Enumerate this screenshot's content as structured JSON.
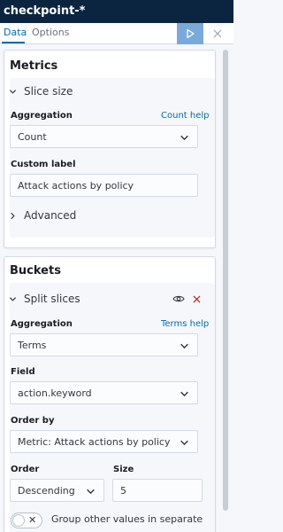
{
  "header": {
    "title": "checkpoint-*"
  },
  "tabs": [
    {
      "label": "Data",
      "active": true
    },
    {
      "label": "Options",
      "active": false
    }
  ],
  "toolbar": {
    "run_icon": "play-icon",
    "close_icon": "close-icon"
  },
  "metrics": {
    "title": "Metrics",
    "agg_title": "Slice size",
    "aggregation_label": "Aggregation",
    "aggregation_help": "Count help",
    "aggregation_value": "Count",
    "custom_label_label": "Custom label",
    "custom_label_value": "Attack actions by policy",
    "advanced_label": "Advanced"
  },
  "buckets": {
    "title": "Buckets",
    "agg_title": "Split slices",
    "aggregation_label": "Aggregation",
    "aggregation_help": "Terms help",
    "aggregation_value": "Terms",
    "field_label": "Field",
    "field_value": "action.keyword",
    "order_by_label": "Order by",
    "order_by_value": "Metric: Attack actions by policy",
    "order_label": "Order",
    "order_value": "Descending",
    "size_label": "Size",
    "size_value": "5",
    "group_other_label": "Group other values in separate",
    "group_other_enabled": false
  },
  "colors": {
    "accent": "#006bb4",
    "header_bg": "#0b2540",
    "danger": "#bd271e",
    "run_button": "#79aad9"
  }
}
